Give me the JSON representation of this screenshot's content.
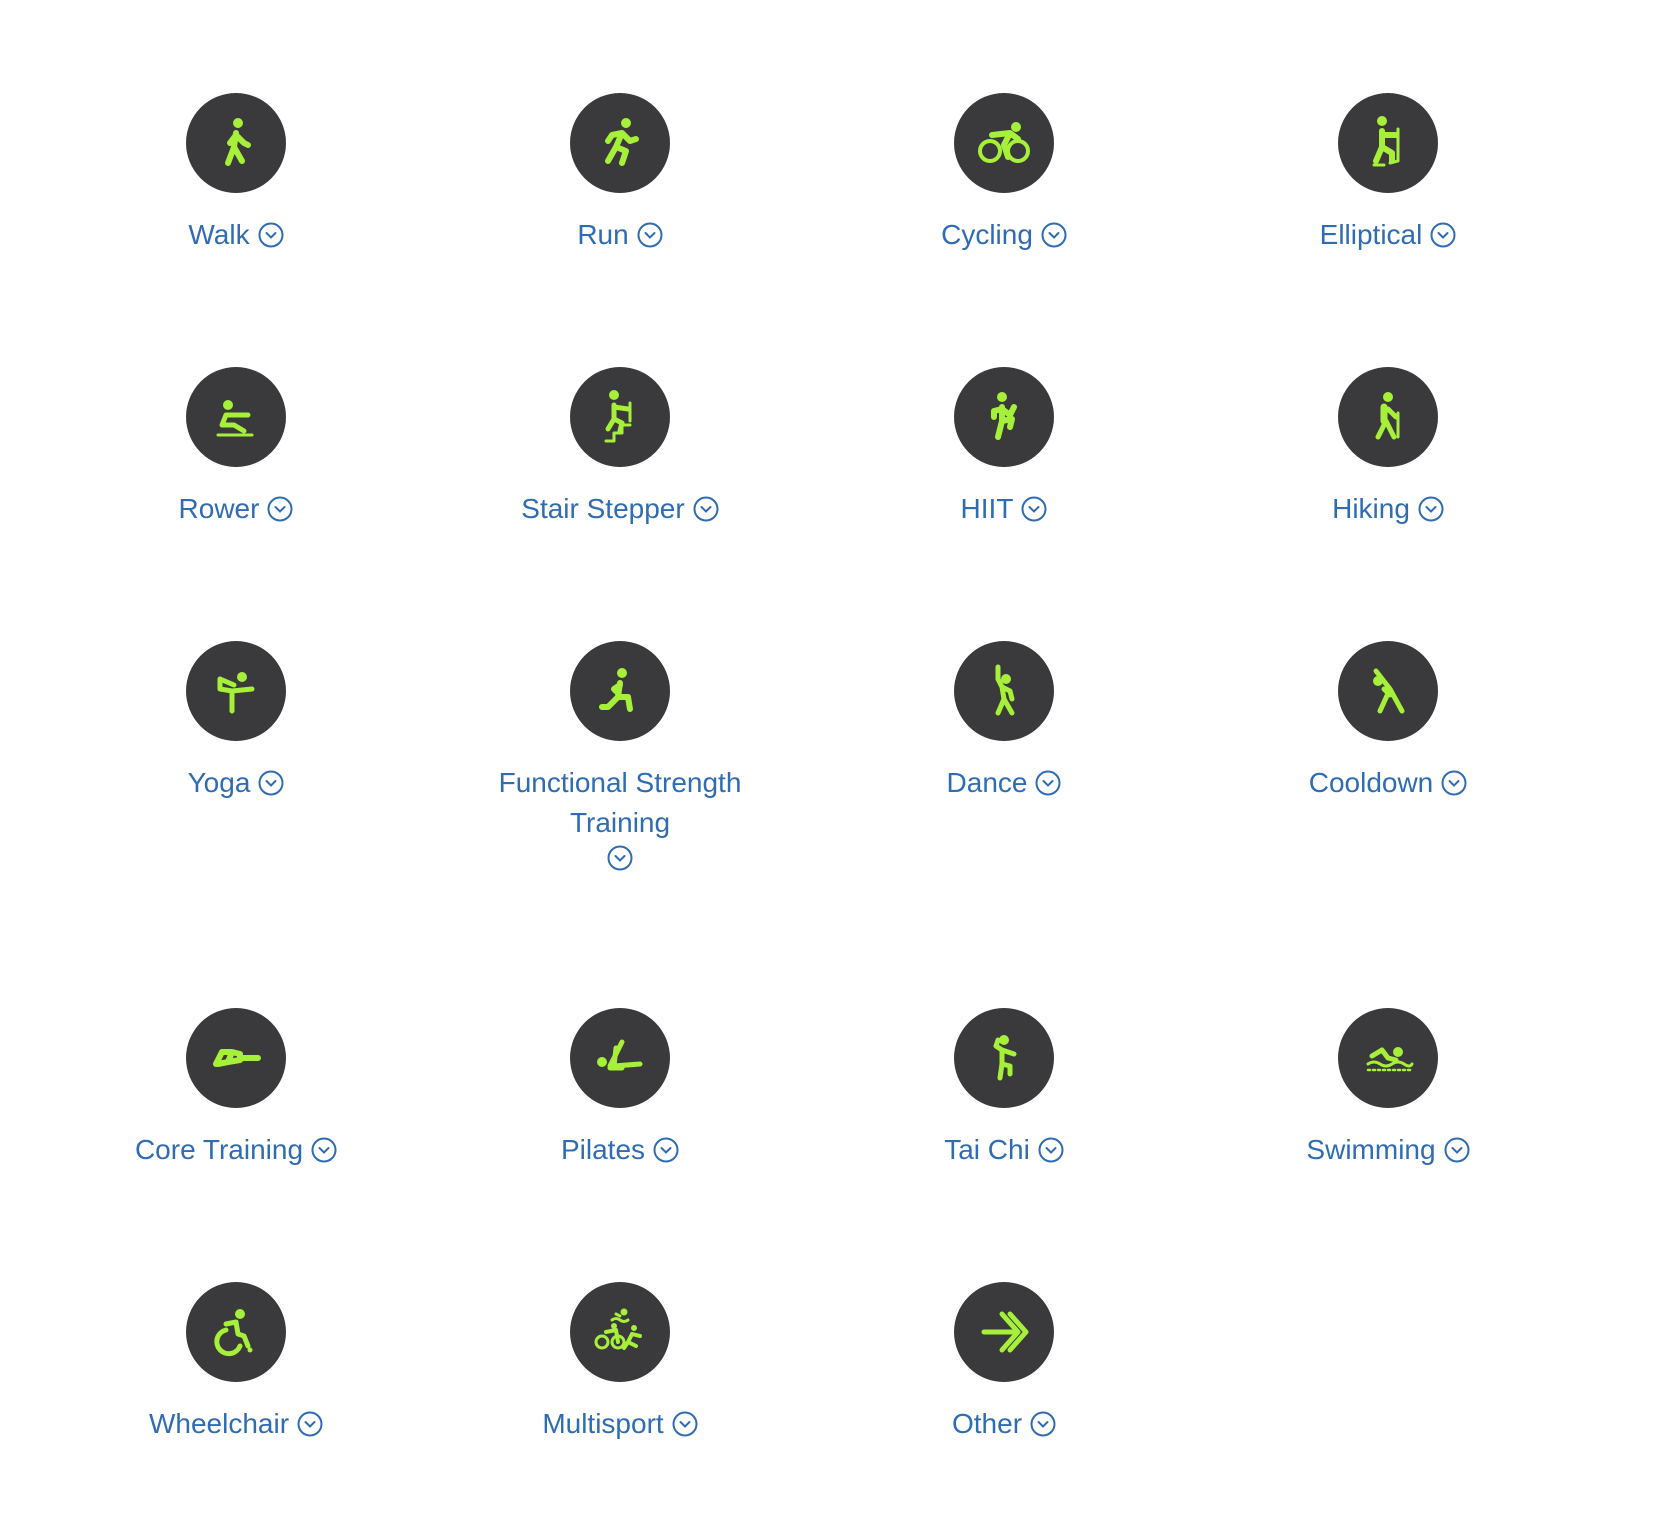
{
  "colors": {
    "icon_background": "#3a3a3c",
    "icon_foreground": "#a6f03a",
    "label_text": "#2f6cb3",
    "page_background": "#ffffff"
  },
  "workouts": [
    {
      "label": "Walk",
      "icon": "walk-icon"
    },
    {
      "label": "Run",
      "icon": "run-icon"
    },
    {
      "label": "Cycling",
      "icon": "cycling-icon"
    },
    {
      "label": "Elliptical",
      "icon": "elliptical-icon"
    },
    {
      "label": "Rower",
      "icon": "rower-icon"
    },
    {
      "label": "Stair Stepper",
      "icon": "stair-stepper-icon"
    },
    {
      "label": "HIIT",
      "icon": "hiit-icon"
    },
    {
      "label": "Hiking",
      "icon": "hiking-icon"
    },
    {
      "label": "Yoga",
      "icon": "yoga-icon"
    },
    {
      "label": "Functional Strength Training",
      "icon": "functional-strength-icon"
    },
    {
      "label": "Dance",
      "icon": "dance-icon"
    },
    {
      "label": "Cooldown",
      "icon": "cooldown-icon"
    },
    {
      "label": "Core Training",
      "icon": "core-training-icon"
    },
    {
      "label": "Pilates",
      "icon": "pilates-icon"
    },
    {
      "label": "Tai Chi",
      "icon": "tai-chi-icon"
    },
    {
      "label": "Swimming",
      "icon": "swimming-icon"
    },
    {
      "label": "Wheelchair",
      "icon": "wheelchair-icon"
    },
    {
      "label": "Multisport",
      "icon": "multisport-icon"
    },
    {
      "label": "Other",
      "icon": "other-icon"
    }
  ],
  "expand_icon": "chevron-down-circle-icon"
}
